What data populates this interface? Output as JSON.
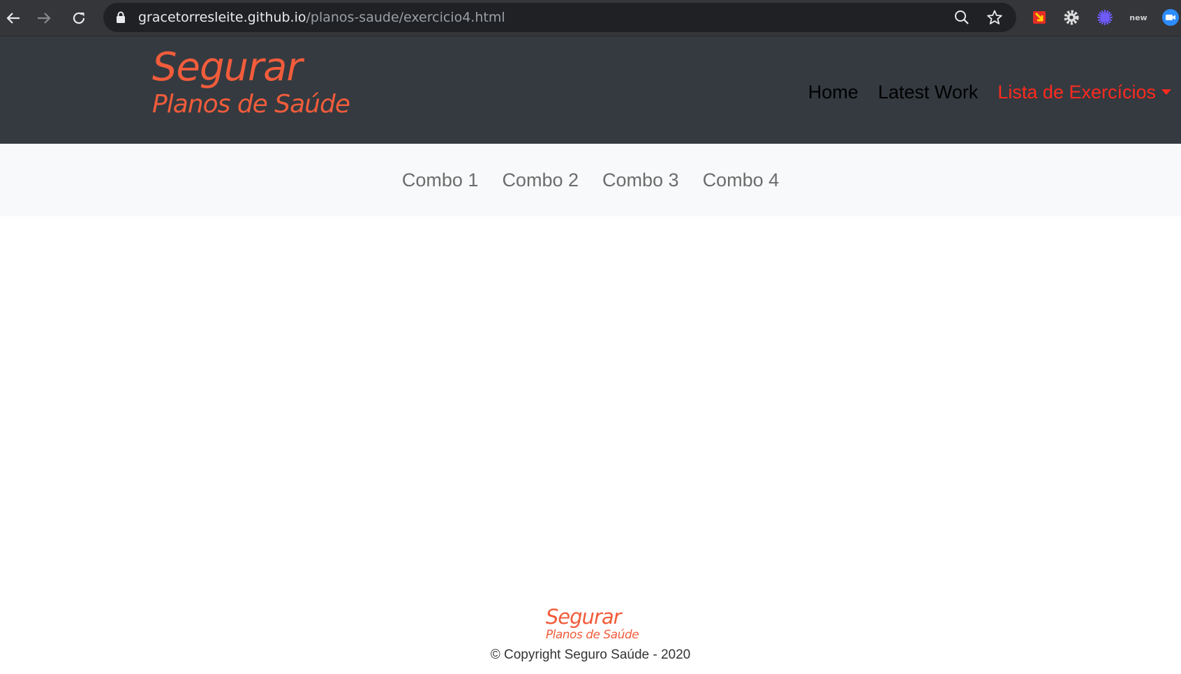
{
  "browser": {
    "url_host": "gracetorresleite.github.io",
    "url_path": "/planos-saude/exercicio4.html",
    "icons": [
      "back-arrow-icon",
      "forward-arrow-icon",
      "reload-icon",
      "lock-icon",
      "zoom-icon",
      "bookmark-star-icon",
      "extension-icon",
      "settings-gear-icon",
      "sparkle-extension-icon",
      "new-extension-icon",
      "zoom-video-icon"
    ],
    "ext_new_label": "new"
  },
  "header": {
    "brand_line1": "Segurar",
    "brand_line2": "Planos de Saúde",
    "nav": {
      "home": "Home",
      "latest_work": "Latest Work",
      "exercises": "Lista de Exercícios"
    },
    "colors": {
      "background": "#343a40",
      "brand": "#f25c3b",
      "active_link": "#ff2a1f"
    }
  },
  "subnav": {
    "items": [
      "Combo 1",
      "Combo 2",
      "Combo 3",
      "Combo 4"
    ],
    "background": "#f8f9fa"
  },
  "footer": {
    "brand_line1": "Segurar",
    "brand_line2": "Planos de Saúde",
    "copyright": "© Copyright Seguro Saúde - 2020"
  }
}
